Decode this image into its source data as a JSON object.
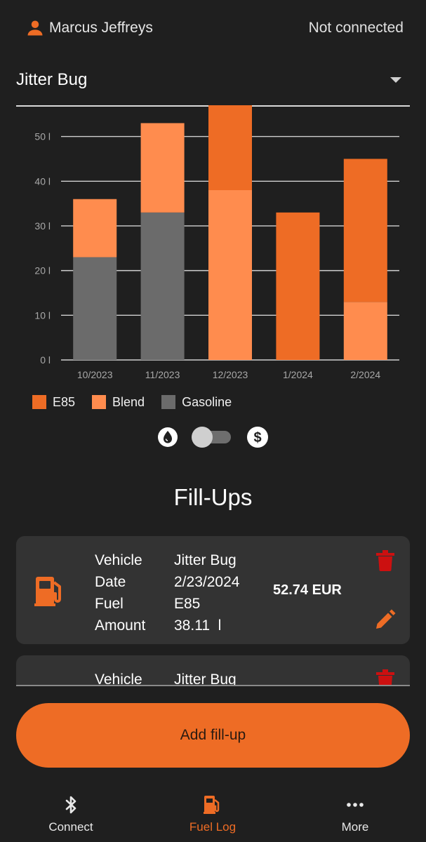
{
  "header": {
    "user_name": "Marcus Jeffreys",
    "connection_status": "Not connected"
  },
  "vehicle_selector": {
    "selected": "Jitter Bug"
  },
  "chart_data": {
    "type": "bar",
    "stacked": true,
    "categories": [
      "10/2023",
      "11/2023",
      "12/2023",
      "1/2024",
      "2/2024"
    ],
    "series": [
      {
        "name": "Gasoline",
        "color": "#6b6b6b",
        "values": [
          23,
          33,
          0,
          0,
          0
        ]
      },
      {
        "name": "Blend",
        "color": "#ff8c4e",
        "values": [
          13,
          20,
          38,
          0,
          13
        ]
      },
      {
        "name": "E85",
        "color": "#ee6c25",
        "values": [
          0,
          0,
          19,
          33,
          32
        ]
      }
    ],
    "ytick_labels": [
      "0 l",
      "10 l",
      "20 l",
      "30 l",
      "40 l",
      "50 l"
    ],
    "ylim": [
      0,
      57
    ],
    "grid": true,
    "legend_position": "bottom-left"
  },
  "legend": [
    {
      "label": "E85",
      "color": "#ee6c25"
    },
    {
      "label": "Blend",
      "color": "#ff8c4e"
    },
    {
      "label": "Gasoline",
      "color": "#6b6b6b"
    }
  ],
  "unit_toggle": {
    "left_icon": "fuel-drop-icon",
    "right_icon": "dollar-icon",
    "state": "off"
  },
  "fillups": {
    "title": "Fill-Ups",
    "field_labels": {
      "vehicle": "Vehicle",
      "date": "Date",
      "fuel": "Fuel",
      "amount": "Amount"
    },
    "items": [
      {
        "vehicle": "Jitter Bug",
        "date": "2/23/2024",
        "fuel": "E85",
        "amount": "38.11  l",
        "cost": "52.74 EUR"
      },
      {
        "vehicle": "Jitter Bug",
        "date": "",
        "fuel": "",
        "amount": "",
        "cost": ""
      }
    ]
  },
  "add_button": {
    "label": "Add fill-up"
  },
  "bottom_nav": {
    "items": [
      {
        "label": "Connect",
        "icon": "bluetooth-icon"
      },
      {
        "label": "Fuel Log",
        "icon": "fuel-pump-icon",
        "active": true
      },
      {
        "label": "More",
        "icon": "more-dots-icon"
      }
    ]
  },
  "colors": {
    "accent": "#ee6c25",
    "background": "#1f1f1f",
    "card": "#333333",
    "delete": "#cc1010"
  }
}
